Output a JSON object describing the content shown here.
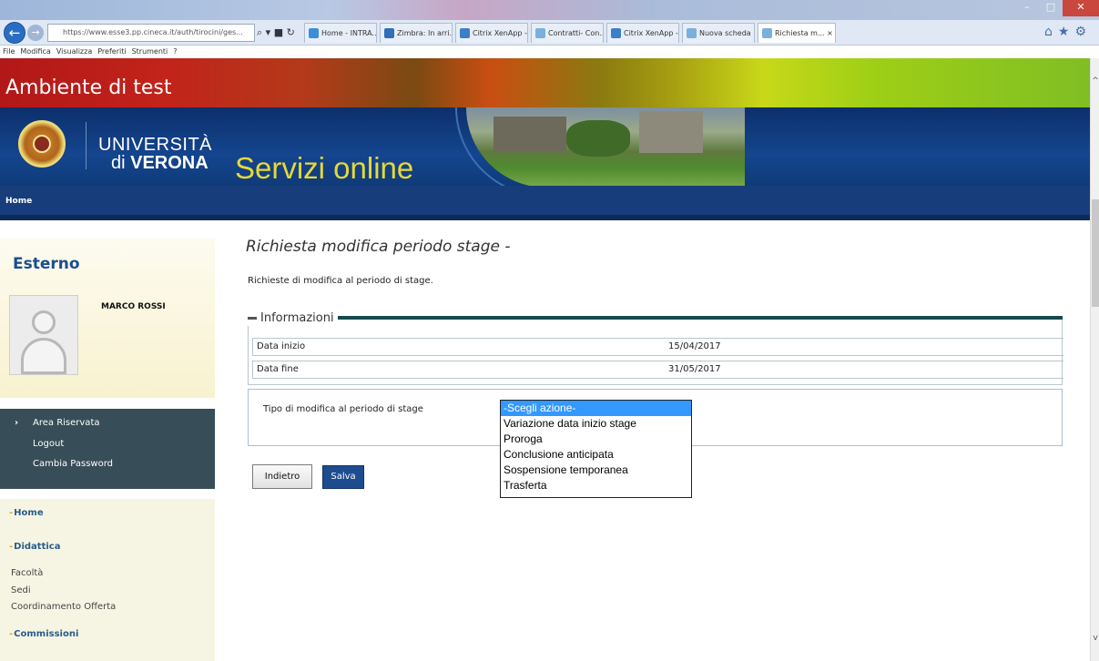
{
  "browser": {
    "address": "https://www.esse3.pp.cineca.it/auth/tirocini/ges...",
    "tabs": [
      {
        "label": "Home - INTRA...",
        "color": "#3a8fd8"
      },
      {
        "label": "Zimbra: In arri...",
        "color": "#2f6fb8"
      },
      {
        "label": "Citrix XenApp - ...",
        "color": "#3a7fc8"
      },
      {
        "label": "Contratti- Con...",
        "color": "#7ab0dd"
      },
      {
        "label": "Citrix XenApp - ...",
        "color": "#3a7fc8"
      },
      {
        "label": "Nuova scheda",
        "color": "#7ab0dd"
      },
      {
        "label": "Richiesta m... ×",
        "color": "#7ab0dd"
      }
    ],
    "menu": [
      "File",
      "Modifica",
      "Visualizza",
      "Preferiti",
      "Strumenti",
      "?"
    ]
  },
  "header": {
    "environment": "Ambiente di test",
    "university_line1": "UNIVERSITÀ",
    "university_line2_prefix": "di ",
    "university_line2_bold": "VERONA",
    "service_title": "Servizi online",
    "home_link": "Home"
  },
  "sidebar": {
    "role": "Esterno",
    "user_name": "MARCO ROSSI",
    "account_links": [
      "Area Riservata",
      "Logout",
      "Cambia Password"
    ],
    "menu": {
      "home": "Home",
      "didattica": "Didattica",
      "didattica_items": [
        "Facoltà",
        "Sedi",
        "Coordinamento Offerta"
      ],
      "commissioni": "Commissioni"
    }
  },
  "main": {
    "title": "Richiesta modifica periodo stage -",
    "description": "Richieste di modifica al periodo di stage.",
    "info_section": "Informazioni",
    "info_rows": [
      {
        "label": "Data inizio",
        "value": "15/04/2017"
      },
      {
        "label": "Data fine",
        "value": "31/05/2017"
      }
    ],
    "tipo_label": "Tipo di modifica al periodo di stage",
    "select_options": [
      "-Scegli azione-",
      "Variazione data inizio stage",
      "Proroga",
      "Conclusione anticipata",
      "Sospensione temporanea",
      "Trasferta"
    ],
    "selected_index": 0,
    "back_button": "Indietro",
    "save_button": "Salva"
  }
}
